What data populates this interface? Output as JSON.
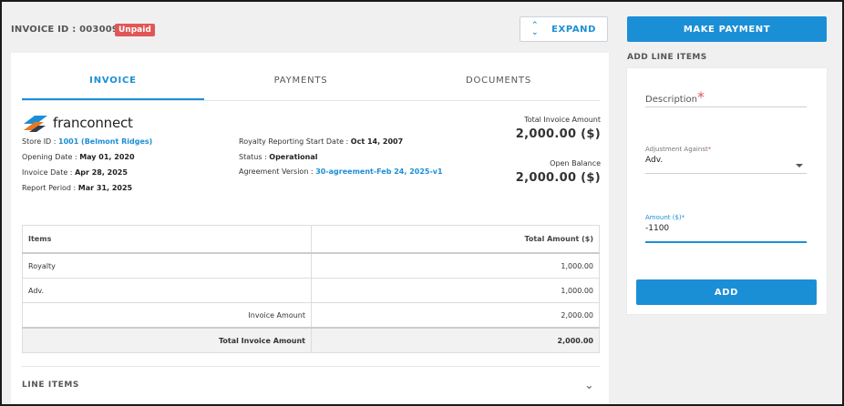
{
  "header": {
    "invoice_id": "INVOICE ID : 003009",
    "status_badge": "Unpaid",
    "expand_label": "EXPAND"
  },
  "tabs": [
    {
      "label": "INVOICE",
      "active": true
    },
    {
      "label": "PAYMENTS",
      "active": false
    },
    {
      "label": "DOCUMENTS",
      "active": false
    }
  ],
  "brand": {
    "logo_text": "franconnect"
  },
  "details": {
    "store_id_label": "Store ID :",
    "store_id_value": "1001 (Belmont Ridges)",
    "opening_date_label": "Opening Date :",
    "opening_date_value": "May 01, 2020",
    "invoice_date_label": "Invoice Date :",
    "invoice_date_value": "Apr 28, 2025",
    "report_period_label": "Report Period :",
    "report_period_value": "Mar 31, 2025",
    "royalty_start_label": "Royalty Reporting Start Date :",
    "royalty_start_value": "Oct 14, 2007",
    "status_label": "Status :",
    "status_value": "Operational",
    "agreement_label": "Agreement Version :",
    "agreement_value": "30-agreement-Feb 24, 2025-v1"
  },
  "summary": {
    "total_label": "Total Invoice Amount",
    "total_value": "2,000.00 ($)",
    "balance_label": "Open Balance",
    "balance_value": "2,000.00 ($)"
  },
  "table": {
    "headers": [
      "Items",
      "Total Amount ($)"
    ],
    "rows": [
      {
        "item": "Royalty",
        "amount": "1,000.00"
      },
      {
        "item": "Adv.",
        "amount": "1,000.00"
      }
    ],
    "invoice_amount_label": "Invoice Amount",
    "invoice_amount_value": "2,000.00",
    "total_label": "Total Invoice Amount",
    "total_value": "2,000.00"
  },
  "line_items_section": {
    "label": "LINE ITEMS"
  },
  "right": {
    "make_payment_label": "MAKE PAYMENT",
    "add_line_items_title": "ADD LINE ITEMS",
    "description_placeholder": "Description",
    "required_mark": "*",
    "adjustment_label": "Adjustment Against",
    "adjustment_value": "Adv.",
    "amount_label": "Amount ($)",
    "amount_value": "-1100",
    "add_label": "ADD"
  },
  "colors": {
    "accent": "#1b8fd6",
    "badge": "#e05757"
  }
}
